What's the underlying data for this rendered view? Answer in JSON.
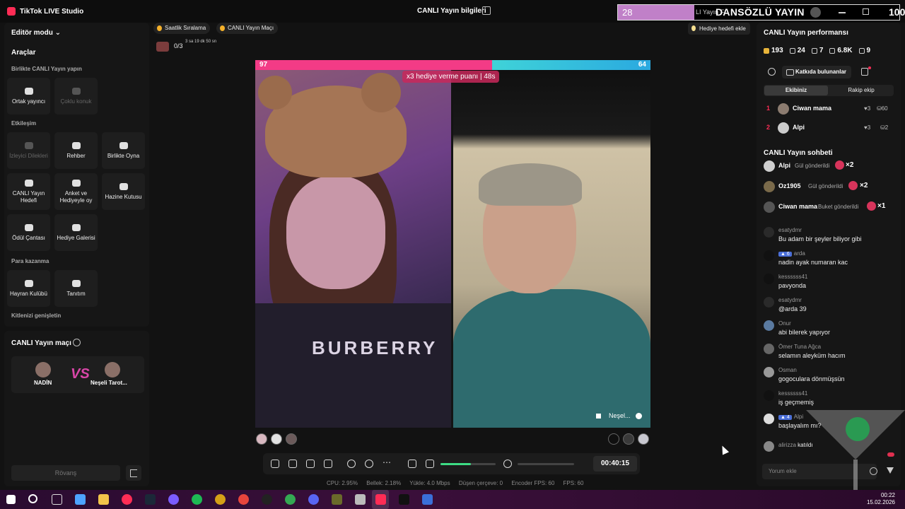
{
  "app": {
    "title": "TikTok LIVE Studio",
    "live_info": "CANLI Yayın bilgileri"
  },
  "banner": {
    "left_num": "28",
    "small_text": "LI Yayın F",
    "text": "DANSÖZLÜ YAYIN",
    "right_num": "100"
  },
  "left": {
    "editor_mode": "Editör modu",
    "tools_title": "Araçlar",
    "section_together": "Birlikte CANLI Yayın yapın",
    "section_interaction": "Etkileşim",
    "section_monetize": "Para kazanma",
    "section_expand": "Kitlenizi genişletin",
    "tools": {
      "cohost": "Ortak yayıncı",
      "multi_guest": "Çoklu konuk",
      "viewer_requests": "İzleyici Dilekleri",
      "guide": "Rehber",
      "play_together": "Birlikte Oyna",
      "live_goal": "CANLI Yayın Hedefi",
      "poll_gift": "Anket ve Hediyeyle oy",
      "treasure_box": "Hazine Kutusu",
      "reward_bag": "Ödül Çantası",
      "gift_gallery": "Hediye Galerisi",
      "fan_club": "Hayran Kulübü",
      "promotion": "Tanıtım"
    },
    "match": {
      "title": "CANLI Yayın maçı",
      "player_a": "NADİN",
      "player_b": "Neşeli Tarot...",
      "vs": "VS",
      "rematch": "Rövanş"
    }
  },
  "top_chips": {
    "hourly_rank": "Saatlik Sıralama",
    "live_match": "CANLI Yayın Maçı",
    "add_gift_goal": "Hediye hedefi ekle",
    "counter": "0/3",
    "countdown": "3 sa 19 dk 50 sn"
  },
  "stream": {
    "score_left": "97",
    "score_right": "64",
    "score_left_share": 0.6,
    "gift_multiplier_text": "x3 hediye verme puanı",
    "gift_timer": "48s",
    "shirt_text": "BURBERRY",
    "guest_name": "Neşel..."
  },
  "controls": {
    "timer": "00:40:15",
    "volume_level": 0.55
  },
  "stats": {
    "cpu": "CPU:  2.95%",
    "memory": "Bellek:  2.18%",
    "upload": "Yükle:  4.0 Mbps",
    "dropped": "Düşen çerçeve:  0",
    "encoder_fps": "Encoder FPS:  60",
    "fps": "FPS:  60"
  },
  "right": {
    "performance_title": "CANLI Yayın performansı",
    "metrics": {
      "diamonds": "193",
      "viewers": "24",
      "shares": "7",
      "likes": "6.8K",
      "gifts": "9"
    },
    "contributors": "Katkıda bulunanlar",
    "tab_team": "Ekibiniz",
    "tab_opponent": "Rakip ekip",
    "ranks": [
      {
        "num": "1",
        "name": "Ciwan mama",
        "hearts": "3",
        "coins": "60"
      },
      {
        "num": "2",
        "name": "Alpi",
        "hearts": "3",
        "coins": "2"
      }
    ],
    "chat_title": "CANLI Yayın sohbeti",
    "gifts": [
      {
        "user": "Alpi",
        "action": "Gül gönderildi",
        "mult": "×2"
      },
      {
        "user": "Oz1905",
        "action": "Gül gönderildi",
        "mult": "×2"
      },
      {
        "user": "Ciwan mama",
        "action": "Buket gönderildi",
        "mult": "×1"
      }
    ],
    "messages": [
      {
        "user": "esatydmr",
        "badge": "",
        "text": "Bu adam bir şeyler biliyor gibi"
      },
      {
        "user": "arda",
        "badge": "6",
        "text": "nadin ayak numaran kac"
      },
      {
        "user": "kessssss41",
        "badge": "",
        "text": "pavyonda"
      },
      {
        "user": "esatydmr",
        "badge": "",
        "text": "@arda 39"
      },
      {
        "user": "Onur",
        "badge": "",
        "text": "abi bilerek yapıyor"
      },
      {
        "user": "Ömer Tuna Ağca",
        "badge": "",
        "text": "selamın aleyküm hacım"
      },
      {
        "user": "Osman",
        "badge": "",
        "text": "gogoculara dönmüşsün"
      },
      {
        "user": "kessssss41",
        "badge": "",
        "text": "iş geçmemiş"
      },
      {
        "user": "Alpi",
        "badge": "4",
        "text": "başlayalım mı?"
      }
    ],
    "joined": {
      "user": "alirizza",
      "text": "katıldı"
    },
    "comment_placeholder": "Yorum ekle"
  },
  "taskbar": {
    "time": "00:22",
    "date": "15.02.2026"
  }
}
